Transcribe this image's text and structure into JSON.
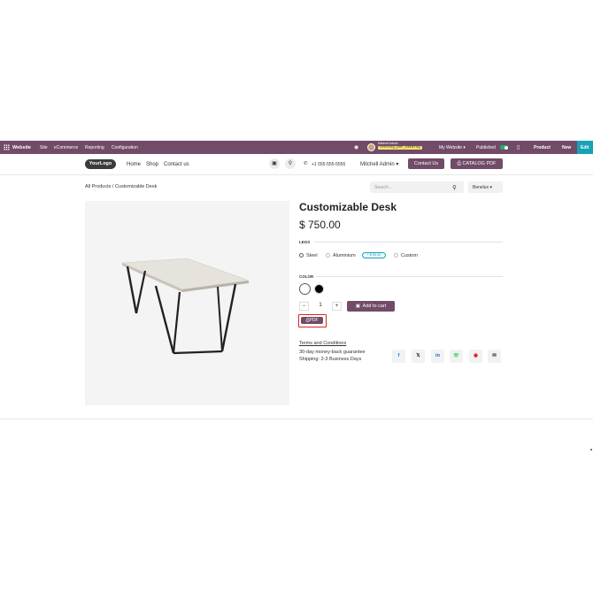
{
  "admin_bar": {
    "app_name": "Website",
    "menu": [
      "Site",
      "eCommerce",
      "Reporting",
      "Configuration"
    ],
    "user_name": "Mitchell Admin",
    "database": "testing_pdf_catalog",
    "my_website": "My Website",
    "published": "Published",
    "product": "Product",
    "new": "New",
    "edit": "Edit"
  },
  "header": {
    "logo": "YourLogo",
    "nav": [
      "Home",
      "Shop",
      "Contact us"
    ],
    "phone": "+1 555-555-5556",
    "user": "Mitchell Admin",
    "contact_btn": "Contact Us",
    "catalog_btn": "CATALOG PDF"
  },
  "breadcrumb": {
    "root": "All Products",
    "separator": "/",
    "current": "Customizable Desk"
  },
  "search": {
    "placeholder": "Search..."
  },
  "pricelist": "Benelux",
  "product": {
    "name": "Customizable Desk",
    "price": "$ 750.00",
    "legs_label": "LEGS",
    "legs_options": [
      "Steel",
      "Aluminium",
      "Custom"
    ],
    "aluminium_extra": "+ $ 50.40",
    "color_label": "COLOR",
    "colors": [
      "#ffffff",
      "#000000"
    ],
    "quantity": "1",
    "add_to_cart": "Add to cart",
    "pdf": "PDF",
    "terms": "Terms and Conditions",
    "guarantee": "30-day money-back guarantee",
    "shipping": "Shipping: 2-3 Business Days"
  },
  "share_icons": [
    "facebook-icon",
    "x-icon",
    "linkedin-icon",
    "whatsapp-icon",
    "pinterest-icon",
    "email-icon"
  ]
}
